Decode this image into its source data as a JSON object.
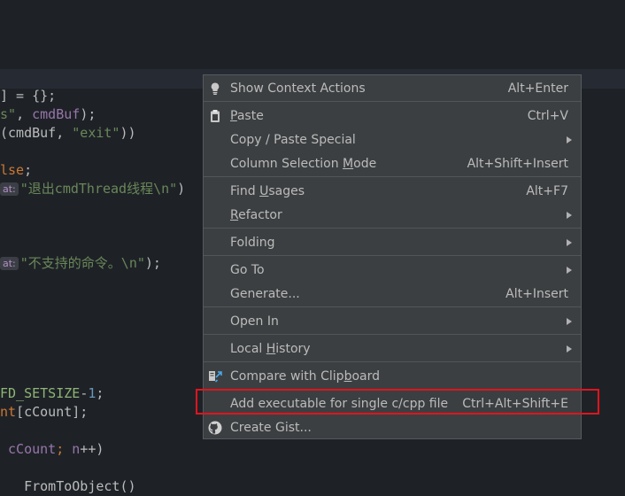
{
  "editor": {
    "lines": [
      {
        "segments": [
          {
            "t": "] = {};",
            "c": ""
          }
        ]
      },
      {
        "segments": [
          {
            "t": "s\"",
            "c": "str"
          },
          {
            "t": ", ",
            "c": ""
          },
          {
            "t": "cmdBuf",
            "c": "purple"
          },
          {
            "t": ");",
            "c": ""
          }
        ]
      },
      {
        "segments": [
          {
            "t": "(cmdBuf, ",
            "c": ""
          },
          {
            "t": "\"exit\"",
            "c": "str"
          },
          {
            "t": "))",
            "c": ""
          }
        ]
      },
      {
        "segments": [
          {
            "t": "lse",
            "c": "kw"
          },
          {
            "t": ";",
            "c": ""
          }
        ]
      },
      {
        "hint": "at:",
        "segments": [
          {
            "t": "\"退出cmdThread线程\\n\"",
            "c": "str"
          },
          {
            "t": ")",
            "c": ""
          }
        ]
      },
      {
        "hint": "at:",
        "segments": [
          {
            "t": "\"不支持的命令。\\n\"",
            "c": "str"
          },
          {
            "t": ");",
            "c": ""
          }
        ]
      },
      {
        "segments": [
          {
            "t": "FD_SETSIZE",
            "c": "macro"
          },
          {
            "t": "-",
            "c": ""
          },
          {
            "t": "1",
            "c": "num"
          },
          {
            "t": ";",
            "c": ""
          }
        ]
      },
      {
        "segments": [
          {
            "t": "nt",
            "c": "kw"
          },
          {
            "t": "[cCount];",
            "c": ""
          }
        ]
      },
      {
        "segments": [
          {
            "t": " cCount",
            "c": "purple"
          },
          {
            "t": "; ",
            "c": "kw"
          },
          {
            "t": "n",
            "c": "purple"
          },
          {
            "t": "++)",
            "c": ""
          }
        ]
      },
      {
        "segments": [
          {
            "t": "   FromToObject()",
            "c": ""
          }
        ]
      }
    ]
  },
  "menu": {
    "show_context_actions": {
      "label": "Show Context Actions",
      "shortcut": "Alt+Enter",
      "icon": "lightbulb-icon"
    },
    "paste": {
      "label_u": "P",
      "label_rest": "aste",
      "shortcut": "Ctrl+V",
      "icon": "clipboard-icon"
    },
    "copy_paste_special": {
      "label": "Copy / Paste Special"
    },
    "column_selection_mode": {
      "label_pre": "Column Selection ",
      "label_u": "M",
      "label_post": "ode",
      "shortcut": "Alt+Shift+Insert"
    },
    "find_usages": {
      "label_pre": "Find ",
      "label_u": "U",
      "label_post": "sages",
      "shortcut": "Alt+F7"
    },
    "refactor": {
      "label_u": "R",
      "label_rest": "efactor"
    },
    "folding": {
      "label": "Folding"
    },
    "go_to": {
      "label": "Go To"
    },
    "generate": {
      "label": "Generate...",
      "shortcut": "Alt+Insert"
    },
    "open_in": {
      "label": "Open In"
    },
    "local_history": {
      "label_pre": "Local ",
      "label_u": "H",
      "label_post": "istory"
    },
    "compare_clipboard": {
      "label_pre": "Compare with Clip",
      "label_u": "b",
      "label_post": "oard",
      "icon": "compare-icon"
    },
    "add_executable": {
      "label": "Add executable for single c/cpp file",
      "shortcut": "Ctrl+Alt+Shift+E"
    },
    "create_gist": {
      "label": "Create Gist...",
      "icon": "github-icon"
    }
  },
  "colors": {
    "highlight_border": "#e0141e",
    "menu_bg": "#3c3f41",
    "editor_bg": "#1e2227"
  }
}
